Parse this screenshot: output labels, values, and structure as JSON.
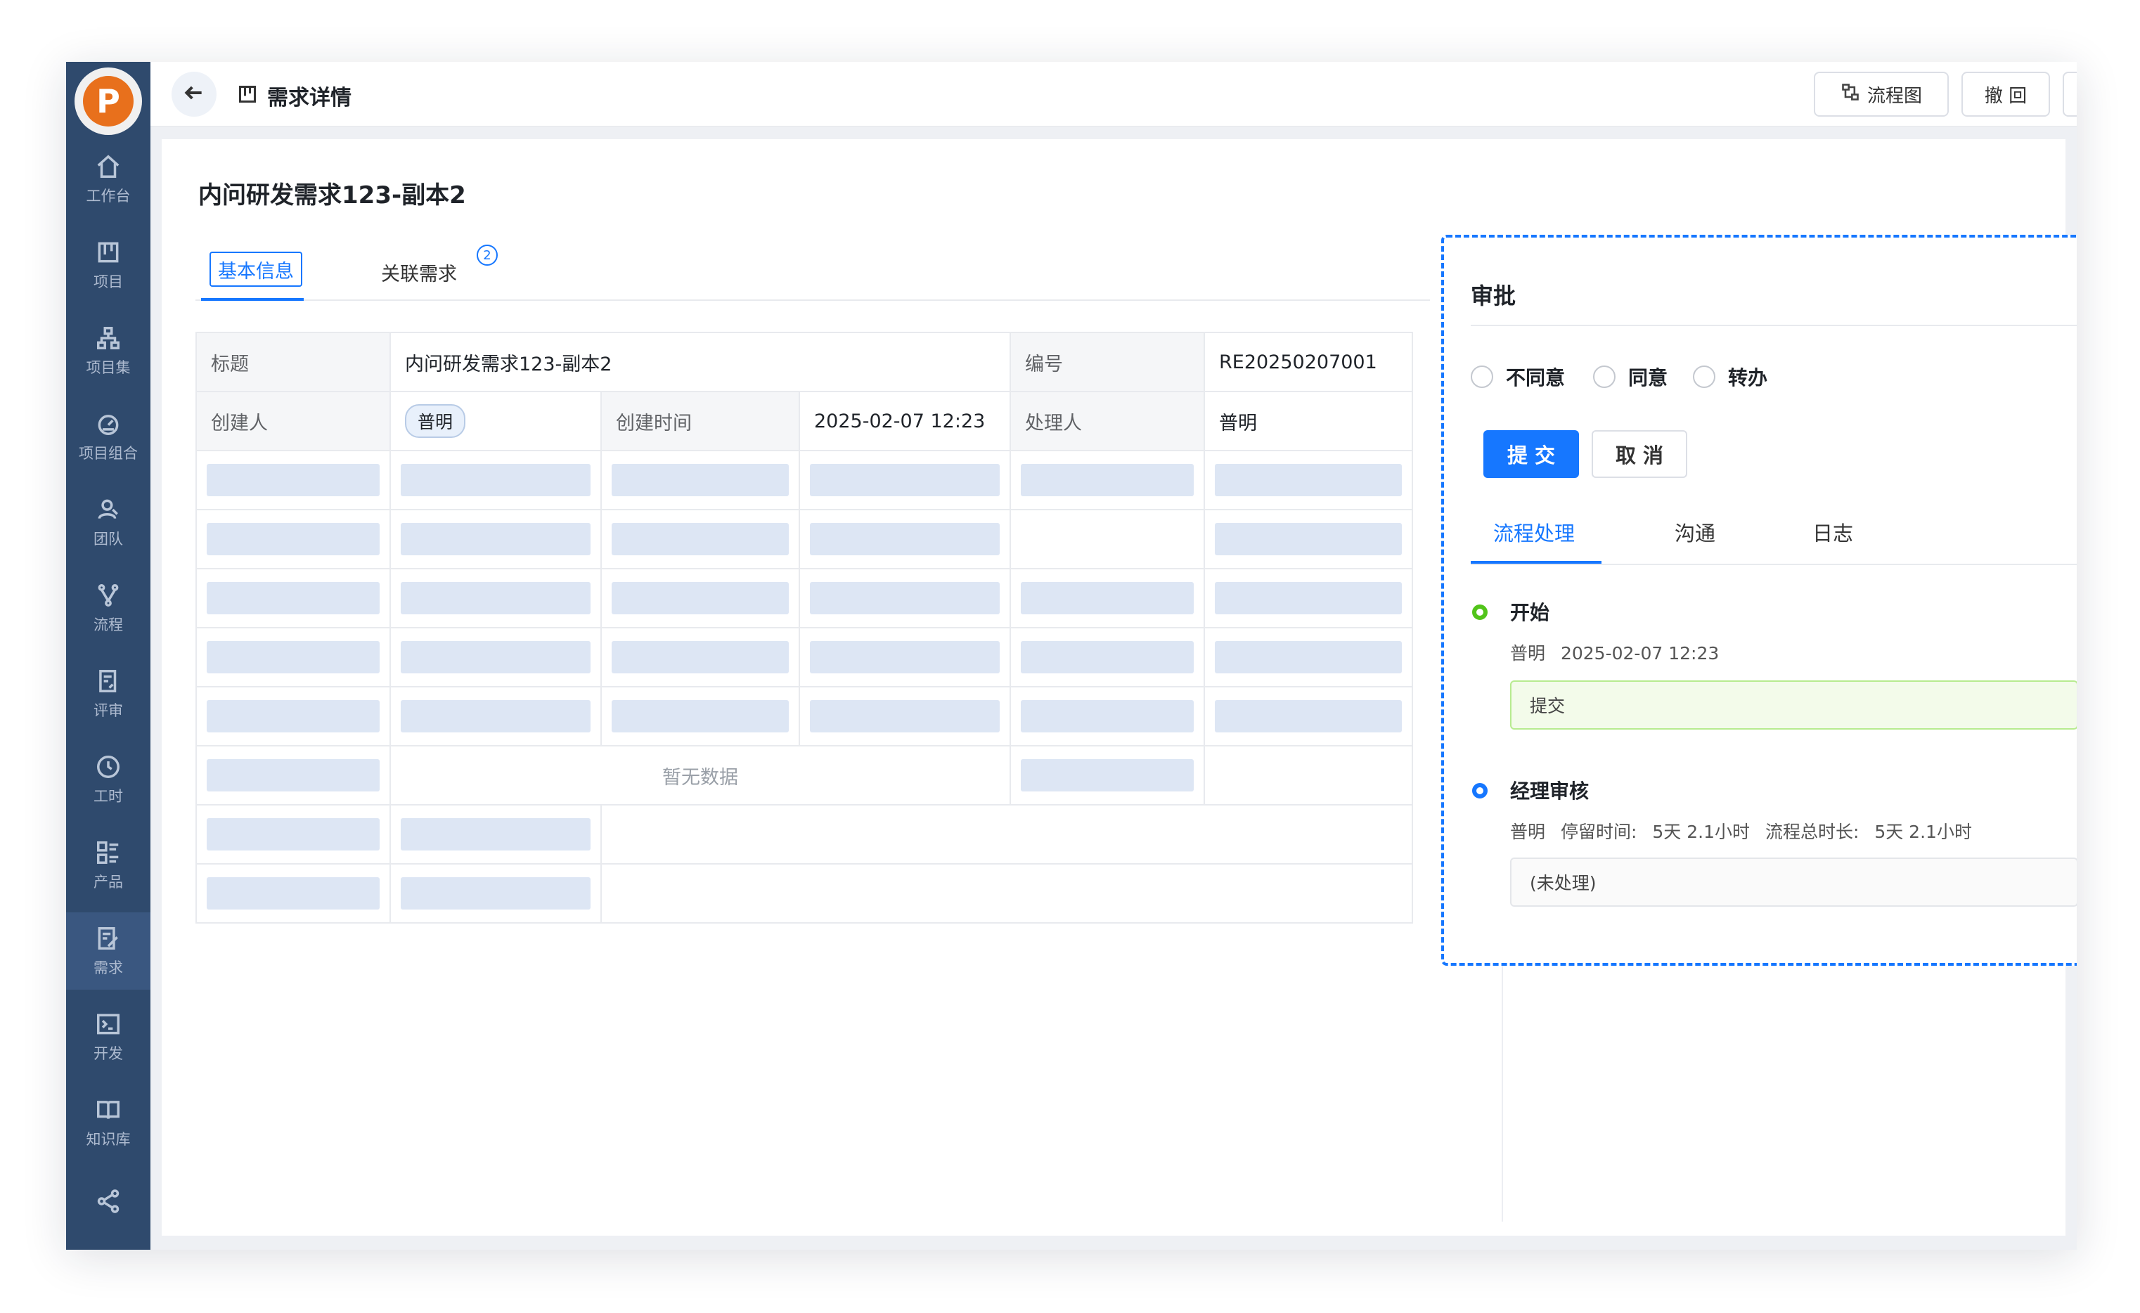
{
  "header": {
    "title": "需求详情",
    "btn_flowchart": "流程图",
    "btn_withdraw": "撤 回",
    "btn_more": "···"
  },
  "sidebar": {
    "items": [
      {
        "label": "工作台",
        "icon": "home-icon"
      },
      {
        "label": "项目",
        "icon": "board-icon"
      },
      {
        "label": "项目集",
        "icon": "hierarchy-icon"
      },
      {
        "label": "项目组合",
        "icon": "dashboard-icon"
      },
      {
        "label": "团队",
        "icon": "team-icon"
      },
      {
        "label": "流程",
        "icon": "flow-icon"
      },
      {
        "label": "评审",
        "icon": "review-icon"
      },
      {
        "label": "工时",
        "icon": "clock-icon"
      },
      {
        "label": "产品",
        "icon": "product-icon"
      },
      {
        "label": "需求",
        "icon": "requirement-icon",
        "active": true
      },
      {
        "label": "开发",
        "icon": "terminal-icon"
      },
      {
        "label": "知识库",
        "icon": "book-icon"
      },
      {
        "label": "",
        "icon": "share-icon"
      }
    ]
  },
  "main": {
    "title": "内问研发需求123-副本2",
    "tabs": [
      {
        "label": "基本信息",
        "active": true
      },
      {
        "label": "关联需求",
        "badge": "2"
      }
    ],
    "table": {
      "title_label": "标题",
      "title_value": "内问研发需求123-副本2",
      "code_label": "编号",
      "code_value": "RE20250207001",
      "creator_label": "创建人",
      "creator_value": "普明",
      "created_time_label": "创建时间",
      "created_time_value": "2025-02-07 12:23",
      "handler_label": "处理人",
      "handler_value": "普明",
      "empty_text": "暂无数据"
    }
  },
  "approval": {
    "title": "审批",
    "options": [
      "不同意",
      "同意",
      "转办"
    ],
    "submit_label": "提 交",
    "cancel_label": "取 消",
    "tabs": [
      "流程处理",
      "沟通",
      "日志"
    ],
    "steps": [
      {
        "title": "开始",
        "user": "普明",
        "time": "2025-02-07 12:23",
        "box": "提交",
        "status_color": "#52c41a"
      },
      {
        "title": "经理审核",
        "user": "普明",
        "stay_label": "停留时间:",
        "stay_value": "5天 2.1小时",
        "total_label": "流程总时长:",
        "total_value": "5天 2.1小时",
        "box": "(未处理)",
        "status_color": "#1677ff"
      }
    ]
  },
  "colors": {
    "accent": "#1677ff",
    "sidebar": "#2f4a6d",
    "success": "#52c41a",
    "logo": "#e8701c"
  }
}
